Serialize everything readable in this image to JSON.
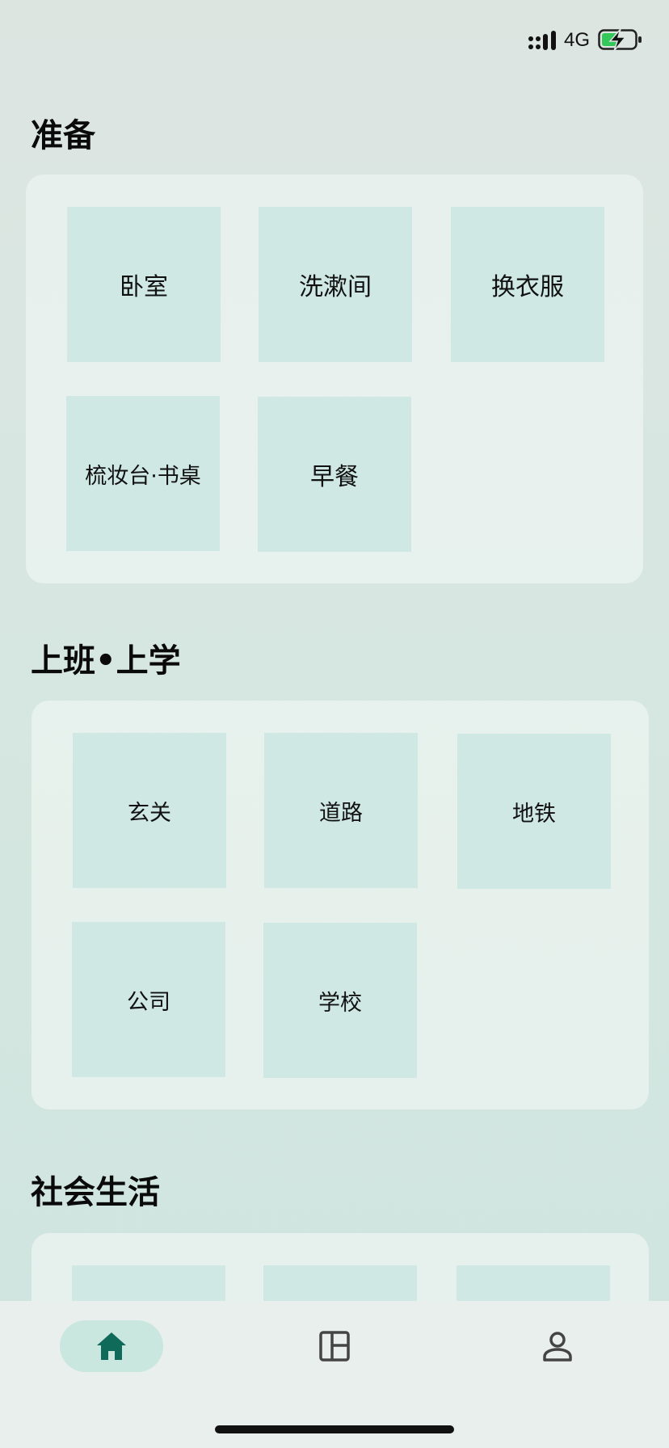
{
  "status_bar": {
    "network": "4G",
    "battery_state": "charging",
    "battery_color": "#34c759"
  },
  "sections": [
    {
      "title": "准备",
      "tiles": [
        "卧室",
        "洗漱间",
        "换衣服",
        "梳妆台·书桌",
        "早餐"
      ]
    },
    {
      "title": "上班•上学",
      "tiles": [
        "玄关",
        "道路",
        "地铁",
        "公司",
        "学校"
      ]
    },
    {
      "title": "社会生活",
      "tiles": []
    }
  ],
  "tab_bar": {
    "active_tab": "home",
    "tabs": [
      {
        "id": "home",
        "icon": "home-icon"
      },
      {
        "id": "layout",
        "icon": "layout-icon"
      },
      {
        "id": "profile",
        "icon": "person-icon"
      }
    ],
    "accent_color": "#0f6a5a"
  }
}
